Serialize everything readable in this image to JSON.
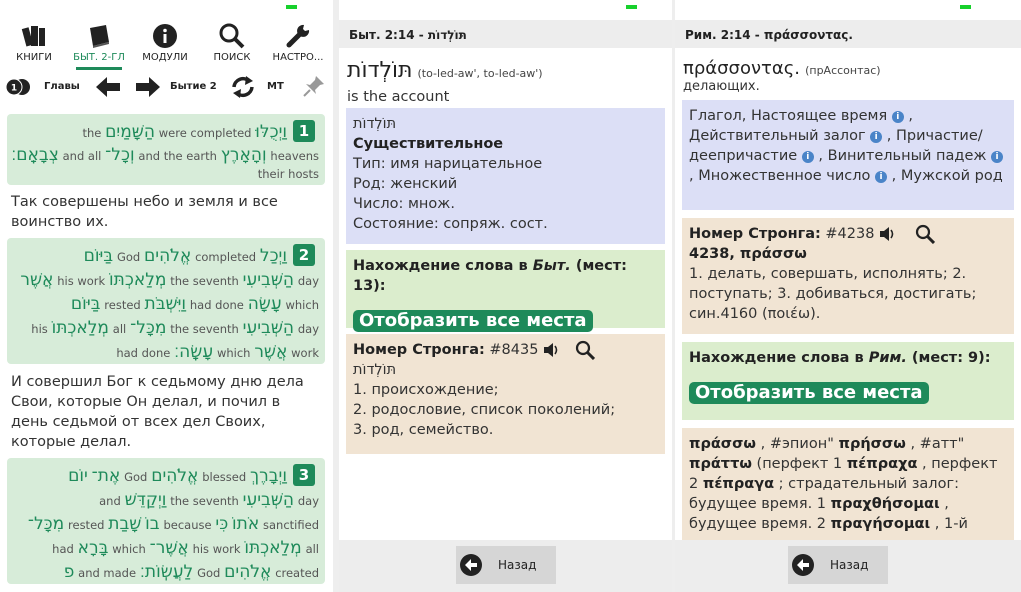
{
  "screen1": {
    "toolbar": [
      {
        "label": "КНИГИ",
        "icon": "books-icon"
      },
      {
        "label": "БЫТ. 2-ГЛ",
        "icon": "book-icon",
        "active": true
      },
      {
        "label": "МОДУЛИ",
        "icon": "info-icon"
      },
      {
        "label": "ПОИСК",
        "icon": "search-icon"
      },
      {
        "label": "НАСТРО...",
        "icon": "wrench-icon"
      }
    ],
    "nav": {
      "chapters": "Главы",
      "current": "Бытие 2",
      "mt": "MT"
    },
    "verses": [
      {
        "num": "1",
        "lines": [
          [
            "וַיְכֻלּוּ",
            "were completed",
            "הַשָּׁמַיִם",
            "the"
          ],
          [
            "וְהָאָרֶץ",
            "heavens",
            "and the earth",
            "וְכָל־",
            "and all",
            "צְבָאָֽם׃"
          ],
          [
            "their hosts"
          ]
        ],
        "translation": "Так совершены небо и земля и все воинство их."
      },
      {
        "num": "2",
        "lines": [
          [
            "וַיְכַל",
            "completed",
            "אֱלֹהִים",
            "God",
            "בַּיּוֹם"
          ],
          [
            "day",
            "הַשְּׁבִיעִי",
            "the seventh",
            "מְלַאכְתּוֹ",
            "his work",
            "אֲשֶׁר"
          ],
          [
            "which",
            "עָשָׂה",
            "had done",
            "וַיִּשְׁבֹּת",
            "rested",
            "בַּיּוֹם"
          ],
          [
            "day",
            "הַשְּׁבִיעִי",
            "the seventh",
            "מִכָּל־",
            "all",
            "מְלַאכְתּוֹ",
            "his"
          ],
          [
            "work",
            "אֲשֶׁר",
            "which",
            "עָשָֽׂה׃",
            "had done"
          ]
        ],
        "translation": "И совершил Бог к седьмому дню дела Свои, которые Он делал, и почил в день седьмой от всех дел Своих, которые делал."
      },
      {
        "num": "3",
        "lines": [
          [
            "וַיְבָרֶךְ",
            "blessed",
            "אֱלֹהִים",
            "God",
            "אֶת־",
            "יוֹם"
          ],
          [
            "day",
            "הַשְּׁבִיעִי",
            "the seventh",
            "וַיְקַדֵּשׁ",
            "and"
          ],
          [
            "sanctified",
            "אֹתוֹ",
            "כִּי",
            "because",
            "בוֹ",
            "שָׁבַת",
            "rested",
            "מִכָּל־"
          ],
          [
            "all",
            "מְלַאכְתּוֹ",
            "his work",
            "אֲשֶׁר־",
            "which",
            "בָּרָא",
            "had"
          ],
          [
            "created",
            "אֱלֹהִים",
            "God",
            "לַעֲשֽׂוֹת׃",
            "and made",
            "פ"
          ]
        ]
      }
    ]
  },
  "screen2": {
    "header": "Быт. 2:14 - תּוֹלְדוֹת",
    "word": "תּוֹלְדוֹת",
    "translit": "(to-led-aw', to-led-aw')",
    "gloss": "is the account",
    "morph": {
      "word": "תּוֹלְדוֹת",
      "pos": "Существительное",
      "lines": [
        "Тип: имя нарицательное",
        "Род: женский",
        "Число: множ.",
        "Состояние: сопряж. сост."
      ]
    },
    "occurrences": {
      "label": "Нахождение слова в ",
      "book": "Быт.",
      "count": " (мест: 13):",
      "button": "Отобразить все места"
    },
    "strong": {
      "label": "Номер Стронга:",
      "number": "#8435",
      "word": "תּוֹלְדוֹת",
      "lines": [
        "1. происхождение;",
        "2. родословие, список поколений;",
        "3. род, семейство."
      ]
    },
    "back": "Назад"
  },
  "screen3": {
    "header": "Рим. 2:14 - πράσσοντας.",
    "word": "πράσσοντας.",
    "translit": "(прАссонтас)",
    "gloss": "делающих.",
    "morph": {
      "parts": [
        "Глагол, Настоящее время",
        " , Действительный залог",
        " , Причастие/деепричастие",
        " , Винительный падеж",
        " , Множественное число",
        " , Мужской род"
      ]
    },
    "strong": {
      "label": "Номер Стронга:",
      "number": "#4238",
      "title": "4238, πράσσω",
      "text": "1. делать, совершать, исполнять; 2. поступать; 3. добиваться, достигать; син.4160 (ποιέω)."
    },
    "occurrences": {
      "label": "Нахождение слова в ",
      "book": "Рим.",
      "count": " (мест: 9):",
      "button": "Отобразить все места"
    },
    "forms": {
      "t1": "πράσσω",
      "t2": " , #эпион\" ",
      "t3": "πρήσσω",
      "t4": " , #атт\" ",
      "t5": "πράττω",
      "t6": " (перфект 1 ",
      "t7": "πέπραχα",
      "t8": " , перфект 2 ",
      "t9": "πέπραγα",
      "t10": " ; страдательный залог: будущее время. 1 ",
      "t11": "πραχθήσομαι",
      "t12": " , будущее время. 2 ",
      "t13": "πραγήσομαι",
      "t14": " , 1-й"
    },
    "back": "Назад"
  }
}
